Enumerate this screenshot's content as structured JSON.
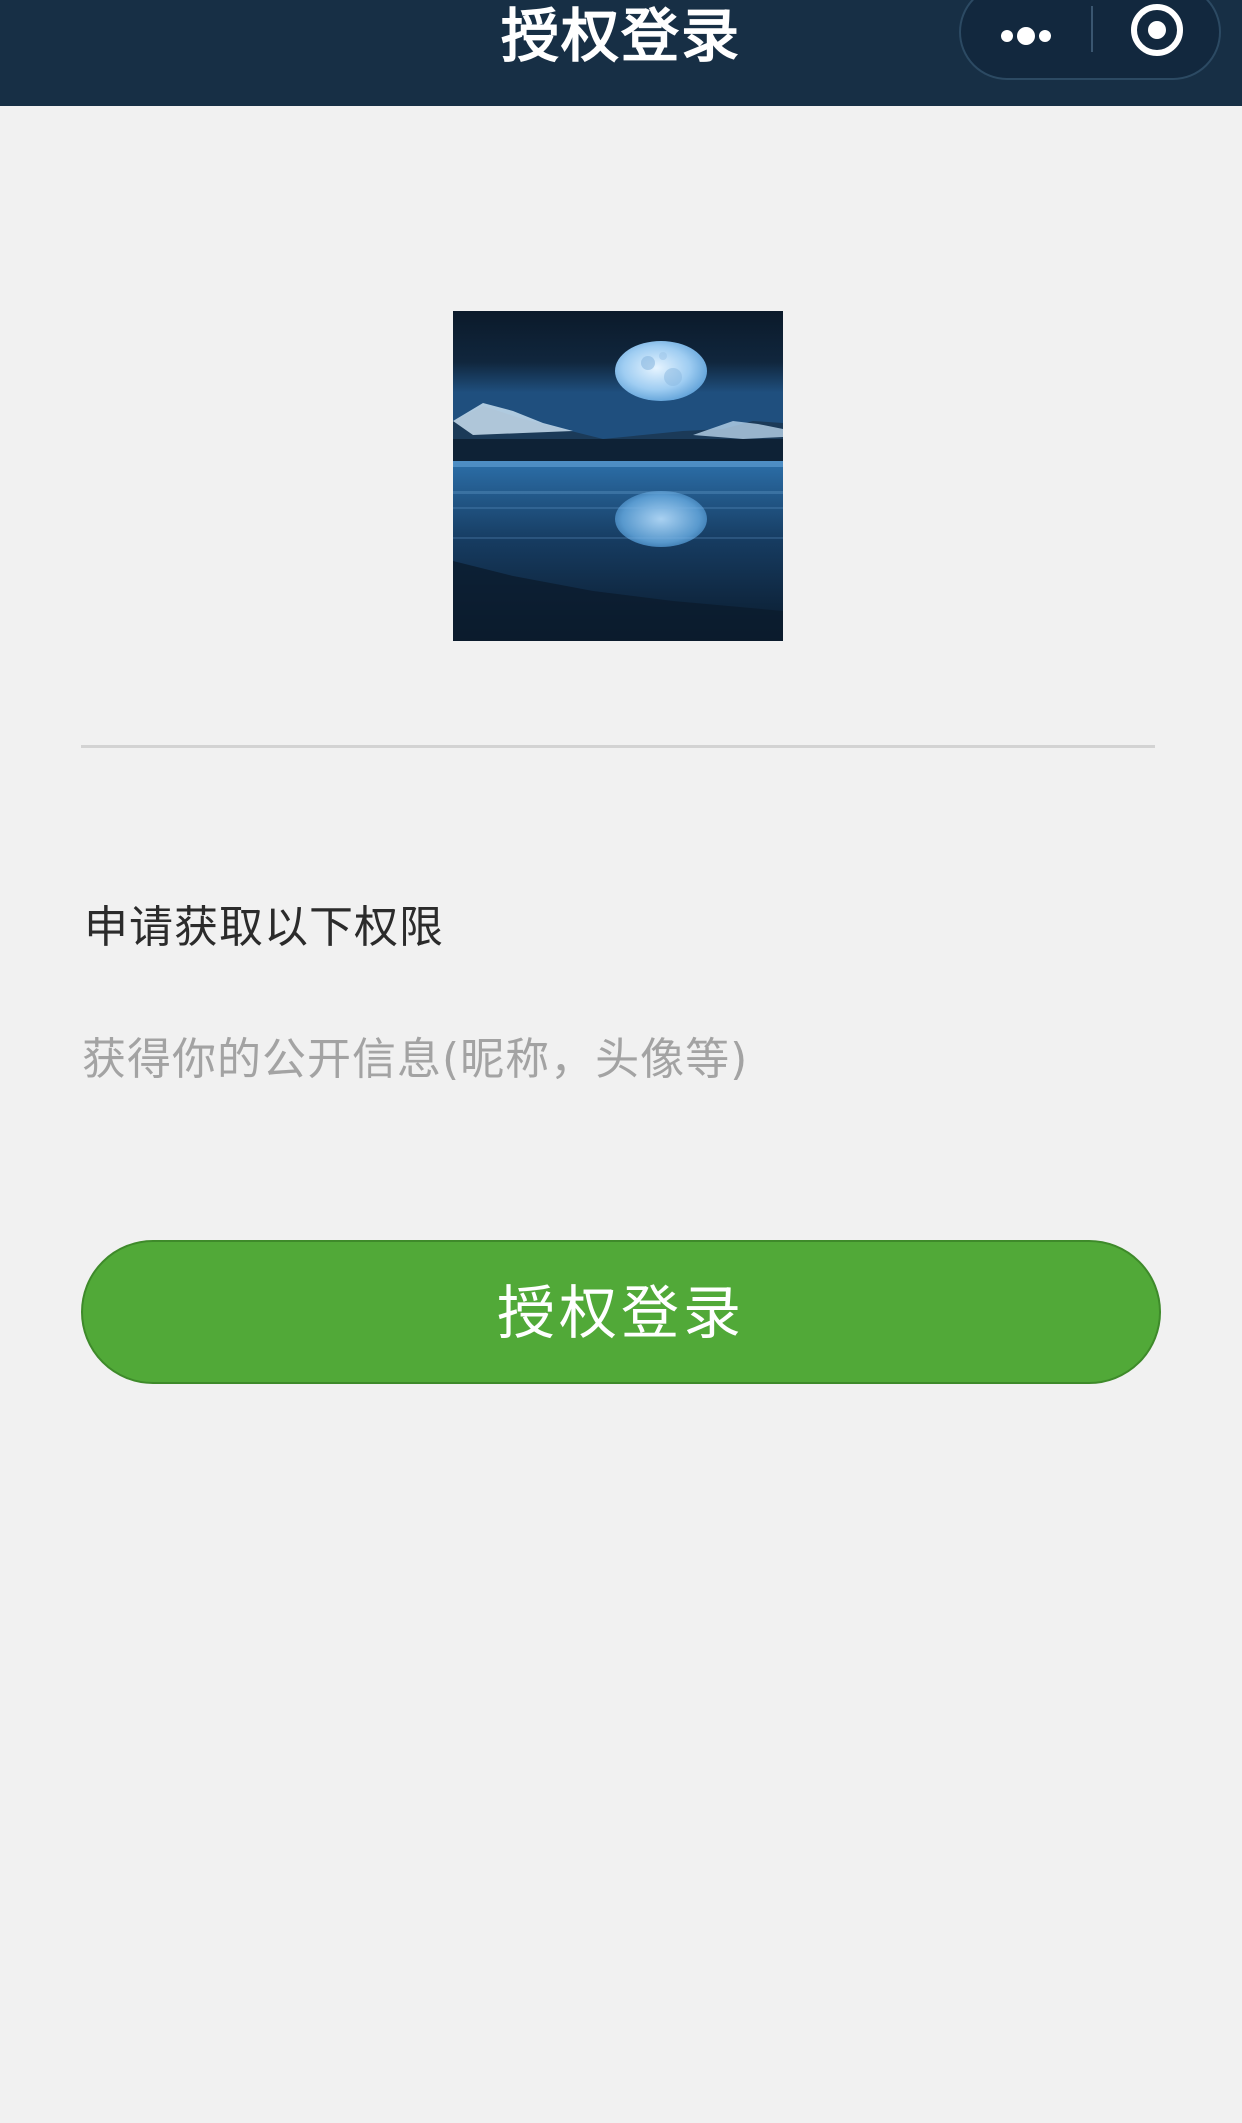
{
  "header": {
    "title": "授权登录",
    "more_icon": "more-dots-icon",
    "close_icon": "target-close-icon",
    "background": "#172f45"
  },
  "logo": {
    "image": "moon-lake-night-picture"
  },
  "permissions": {
    "title": "申请获取以下权限",
    "description": "获得你的公开信息(昵称，头像等)"
  },
  "actions": {
    "authorize_label": "授权登录",
    "button_color": "#51a938"
  }
}
